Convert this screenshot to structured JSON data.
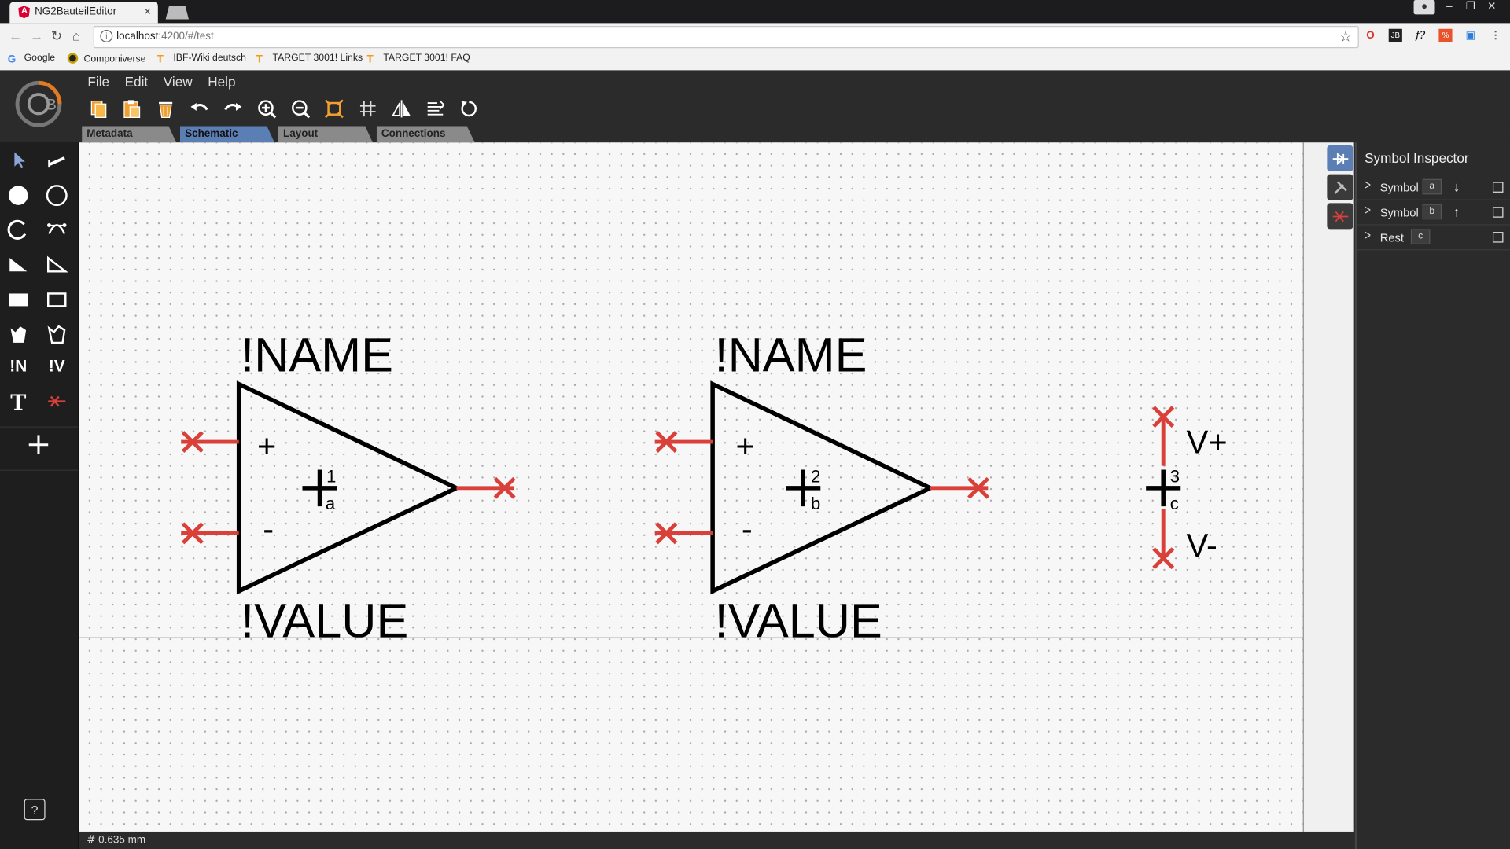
{
  "browser": {
    "tab_title": "NG2BauteilEditor",
    "close_glyph": "×",
    "url_host": "localhost",
    "url_rest": ":4200/#/test",
    "bookmarks": [
      "Google",
      "Componiverse",
      "IBF-Wiki deutsch",
      "TARGET 3001! Links",
      "TARGET 3001! FAQ"
    ]
  },
  "menu": [
    "File",
    "Edit",
    "View",
    "Help"
  ],
  "toolbar_icons": [
    "copy-icon",
    "paste-icon",
    "delete-icon",
    "undo-icon",
    "redo-icon",
    "zoom-in-icon",
    "zoom-out-icon",
    "fit-icon",
    "grid-icon",
    "mirror-icon",
    "align-icon",
    "rotate-icon"
  ],
  "editor_tabs": [
    "Metadata",
    "Schematic",
    "Layout",
    "Connections"
  ],
  "active_tab": "Schematic",
  "sidebar_text": {
    "name_tool": "!N",
    "value_tool": "!V",
    "text_tool": "T",
    "help": "?"
  },
  "schematic": {
    "symbol_a": {
      "name": "!NAME",
      "value": "!VALUE",
      "plus": "+",
      "minus": "-",
      "number": "1",
      "letter": "a"
    },
    "symbol_b": {
      "name": "!NAME",
      "value": "!VALUE",
      "plus": "+",
      "minus": "-",
      "number": "2",
      "letter": "b"
    },
    "rest": {
      "vplus": "V+",
      "vminus": "V-",
      "number": "3",
      "letter": "c"
    },
    "colors": {
      "pin": "#d9403a",
      "body": "#000000"
    }
  },
  "status": {
    "grid": "0.635 mm"
  },
  "inspector": {
    "title": "Symbol Inspector",
    "rows": [
      {
        "label": "Symbol",
        "key": "a",
        "arrow": "↓"
      },
      {
        "label": "Symbol",
        "key": "b",
        "arrow": "↑"
      },
      {
        "label": "Rest",
        "key": "c",
        "arrow": ""
      }
    ]
  }
}
